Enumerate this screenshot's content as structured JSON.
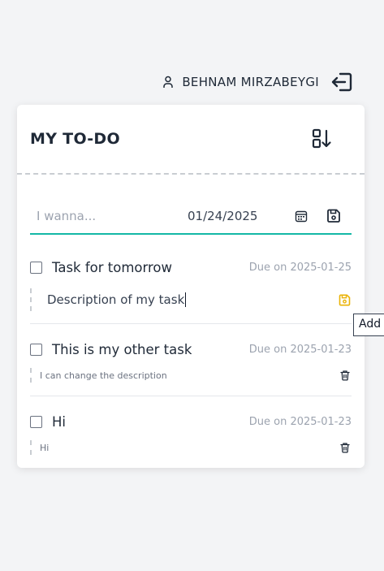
{
  "user": {
    "name": "BEHNAM MIRZABEYGI",
    "icon": "user-icon",
    "logout_icon": "logout-icon"
  },
  "card": {
    "title": "MY TO-DO",
    "sort_icon": "sort-ascending-icon"
  },
  "new_task": {
    "placeholder": "I wanna...",
    "date": "01/24/2025",
    "calendar_icon": "calendar-icon",
    "save_icon": "save-icon"
  },
  "tasks": [
    {
      "title": "Task for tomorrow",
      "due": "Due on 2025-01-25",
      "description": "Description of my task",
      "editing": true,
      "action_icon": "save-icon"
    },
    {
      "title": "This is my other task",
      "due": "Due on 2025-01-23",
      "description": "I can change the description",
      "editing": false,
      "action_icon": "trash-icon"
    },
    {
      "title": "Hi",
      "due": "Due on 2025-01-23",
      "description": "Hi",
      "editing": false,
      "action_icon": "trash-icon"
    }
  ],
  "tooltip": {
    "text": "Add"
  },
  "colors": {
    "accent": "#14b8a6",
    "save_active": "#eab308",
    "background": "#f3f4f6"
  }
}
